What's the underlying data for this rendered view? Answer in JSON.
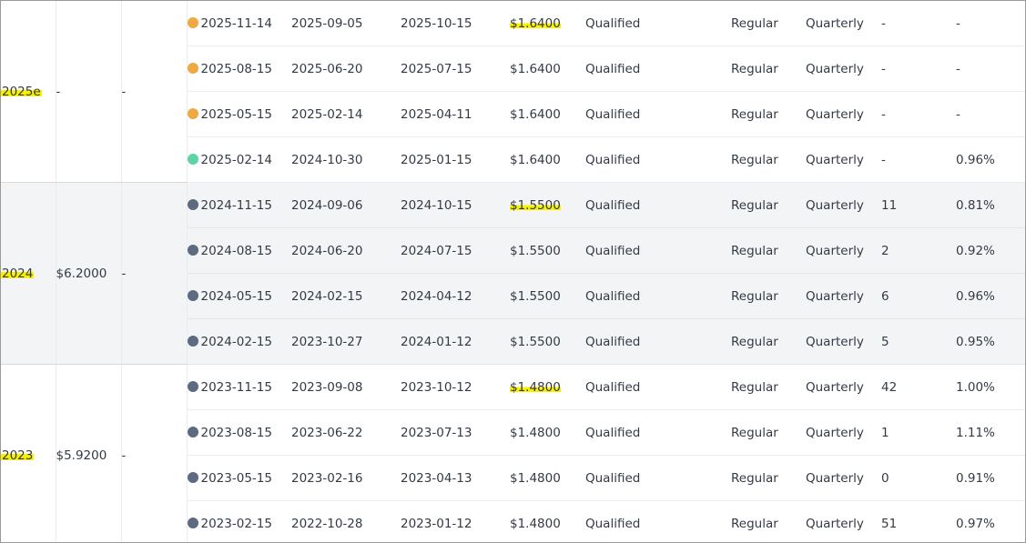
{
  "colors": {
    "estimated": "#f0a843",
    "declared": "#5fd3a6",
    "paid": "#5c6b80",
    "highlight": "#f8f000"
  },
  "groups": [
    {
      "year": "2025e",
      "total": "-",
      "growth": "-",
      "rows": [
        {
          "status": "estimated",
          "pay_date": "2025-11-14",
          "declare_date": "2025-09-05",
          "ex_date": "2025-10-15",
          "amount": "$1.6400",
          "qualified": "Qualified",
          "type": "Regular",
          "frequency": "Quarterly",
          "days": "-",
          "yield": "-"
        },
        {
          "status": "estimated",
          "pay_date": "2025-08-15",
          "declare_date": "2025-06-20",
          "ex_date": "2025-07-15",
          "amount": "$1.6400",
          "qualified": "Qualified",
          "type": "Regular",
          "frequency": "Quarterly",
          "days": "-",
          "yield": "-"
        },
        {
          "status": "estimated",
          "pay_date": "2025-05-15",
          "declare_date": "2025-02-14",
          "ex_date": "2025-04-11",
          "amount": "$1.6400",
          "qualified": "Qualified",
          "type": "Regular",
          "frequency": "Quarterly",
          "days": "-",
          "yield": "-"
        },
        {
          "status": "declared",
          "pay_date": "2025-02-14",
          "declare_date": "2024-10-30",
          "ex_date": "2025-01-15",
          "amount": "$1.6400",
          "qualified": "Qualified",
          "type": "Regular",
          "frequency": "Quarterly",
          "days": "-",
          "yield": "0.96%"
        }
      ]
    },
    {
      "year": "2024",
      "total": "$6.2000",
      "growth": "-",
      "rows": [
        {
          "status": "paid",
          "pay_date": "2024-11-15",
          "declare_date": "2024-09-06",
          "ex_date": "2024-10-15",
          "amount": "$1.5500",
          "qualified": "Qualified",
          "type": "Regular",
          "frequency": "Quarterly",
          "days": "11",
          "yield": "0.81%"
        },
        {
          "status": "paid",
          "pay_date": "2024-08-15",
          "declare_date": "2024-06-20",
          "ex_date": "2024-07-15",
          "amount": "$1.5500",
          "qualified": "Qualified",
          "type": "Regular",
          "frequency": "Quarterly",
          "days": "2",
          "yield": "0.92%"
        },
        {
          "status": "paid",
          "pay_date": "2024-05-15",
          "declare_date": "2024-02-15",
          "ex_date": "2024-04-12",
          "amount": "$1.5500",
          "qualified": "Qualified",
          "type": "Regular",
          "frequency": "Quarterly",
          "days": "6",
          "yield": "0.96%"
        },
        {
          "status": "paid",
          "pay_date": "2024-02-15",
          "declare_date": "2023-10-27",
          "ex_date": "2024-01-12",
          "amount": "$1.5500",
          "qualified": "Qualified",
          "type": "Regular",
          "frequency": "Quarterly",
          "days": "5",
          "yield": "0.95%"
        }
      ]
    },
    {
      "year": "2023",
      "total": "$5.9200",
      "growth": "-",
      "rows": [
        {
          "status": "paid",
          "pay_date": "2023-11-15",
          "declare_date": "2023-09-08",
          "ex_date": "2023-10-12",
          "amount": "$1.4800",
          "qualified": "Qualified",
          "type": "Regular",
          "frequency": "Quarterly",
          "days": "42",
          "yield": "1.00%"
        },
        {
          "status": "paid",
          "pay_date": "2023-08-15",
          "declare_date": "2023-06-22",
          "ex_date": "2023-07-13",
          "amount": "$1.4800",
          "qualified": "Qualified",
          "type": "Regular",
          "frequency": "Quarterly",
          "days": "1",
          "yield": "1.11%"
        },
        {
          "status": "paid",
          "pay_date": "2023-05-15",
          "declare_date": "2023-02-16",
          "ex_date": "2023-04-13",
          "amount": "$1.4800",
          "qualified": "Qualified",
          "type": "Regular",
          "frequency": "Quarterly",
          "days": "0",
          "yield": "0.91%"
        },
        {
          "status": "paid",
          "pay_date": "2023-02-15",
          "declare_date": "2022-10-28",
          "ex_date": "2023-01-12",
          "amount": "$1.4800",
          "qualified": "Qualified",
          "type": "Regular",
          "frequency": "Quarterly",
          "days": "51",
          "yield": "0.97%"
        }
      ]
    }
  ]
}
